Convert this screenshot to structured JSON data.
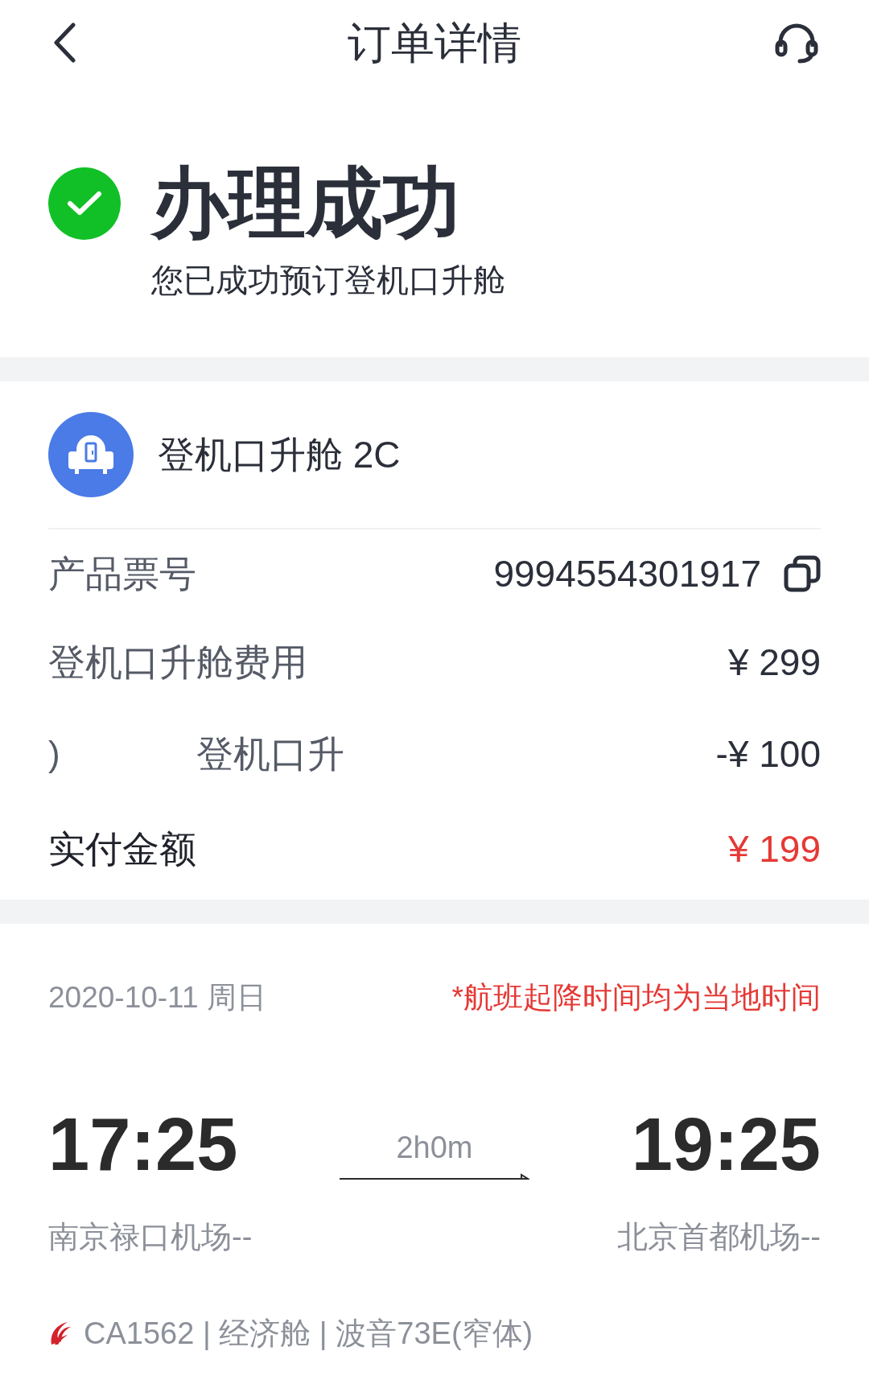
{
  "header": {
    "title": "订单详情"
  },
  "status": {
    "title": "办理成功",
    "subtitle": "您已成功预订登机口升舱"
  },
  "product": {
    "title": "登机口升舱 2C"
  },
  "rows": [
    {
      "kind": "copy",
      "label": "产品票号",
      "value": "9994554301917"
    },
    {
      "kind": "plain",
      "label": "登机口升舱费用",
      "value": "¥ 299"
    },
    {
      "kind": "discount",
      "prefix": ")",
      "label": "登机口升",
      "value": "-¥ 100"
    },
    {
      "kind": "total",
      "label": "实付金额",
      "value": "¥ 199"
    }
  ],
  "flight": {
    "date": "2020-10-11 周日",
    "note": "*航班起降时间均为当地时间",
    "depart_time": "17:25",
    "arrive_time": "19:25",
    "duration": "2h0m",
    "depart_airport": "南京禄口机场--",
    "arrive_airport": "北京首都机场--",
    "info": "CA1562 | 经济舱 | 波音73E(窄体)"
  }
}
